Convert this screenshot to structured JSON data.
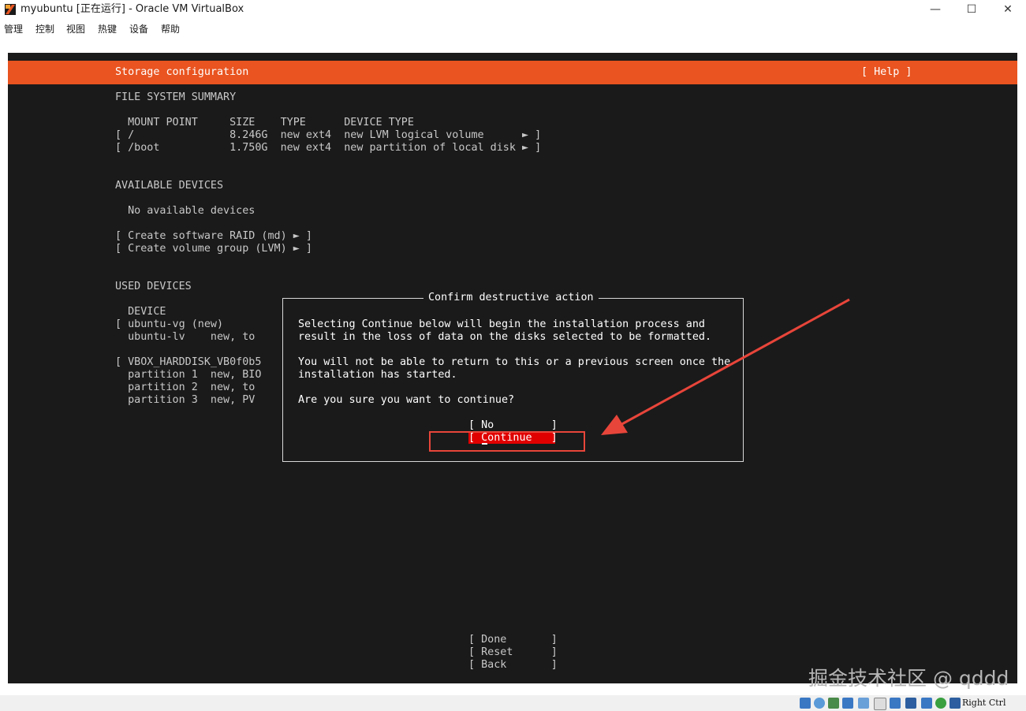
{
  "window": {
    "title": "myubuntu [正在运行] - Oracle VM VirtualBox",
    "minimize_glyph": "—",
    "maximize_glyph": "☐",
    "close_glyph": "✕"
  },
  "menu": [
    "管理",
    "控制",
    "视图",
    "热键",
    "设备",
    "帮助"
  ],
  "installer": {
    "header_title": "Storage configuration",
    "help_label": "[ Help ]",
    "fs_summary": {
      "heading": "FILE SYSTEM SUMMARY",
      "columns_line": "  MOUNT POINT     SIZE    TYPE      DEVICE TYPE",
      "rows": [
        "[ /               8.246G  new ext4  new LVM logical volume      ► ]",
        "[ /boot           1.750G  new ext4  new partition of local disk ► ]"
      ]
    },
    "available": {
      "heading": "AVAILABLE DEVICES",
      "empty_text": "  No available devices",
      "actions": [
        "[ Create software RAID (md) ► ]",
        "[ Create volume group (LVM) ► ]"
      ]
    },
    "used": {
      "heading": "USED DEVICES",
      "device_header": "  DEVICE",
      "rows": [
        "[ ubuntu-vg (new)",
        "  ubuntu-lv    new, to",
        "[ VBOX_HARDDISK_VB0f0b5",
        "  partition 1  new, BIO",
        "  partition 2  new, to",
        "  partition 3  new, PV"
      ]
    },
    "bottom_buttons": {
      "done": "[ Done       ]",
      "reset": "[ Reset      ]",
      "back": "[ Back       ]"
    }
  },
  "dialog": {
    "title": "Confirm destructive action",
    "line1": "Selecting Continue below will begin the installation process and",
    "line2": "result in the loss of data on the disks selected to be formatted.",
    "line3": "You will not be able to return to this or a previous screen once the",
    "line4": "installation has started.",
    "question": "Are you sure you want to continue?",
    "no_label": "[ No         ]",
    "continue_label": "[ Continue   ]"
  },
  "statusbar": {
    "host_key": "Right Ctrl"
  },
  "watermark": "掘金技术社区 @ qddd",
  "colors": {
    "ubuntu_orange": "#e95420",
    "terminal_bg": "#1a1a1a",
    "highlight_red": "#e00000",
    "annotation_red": "#e8453a"
  }
}
